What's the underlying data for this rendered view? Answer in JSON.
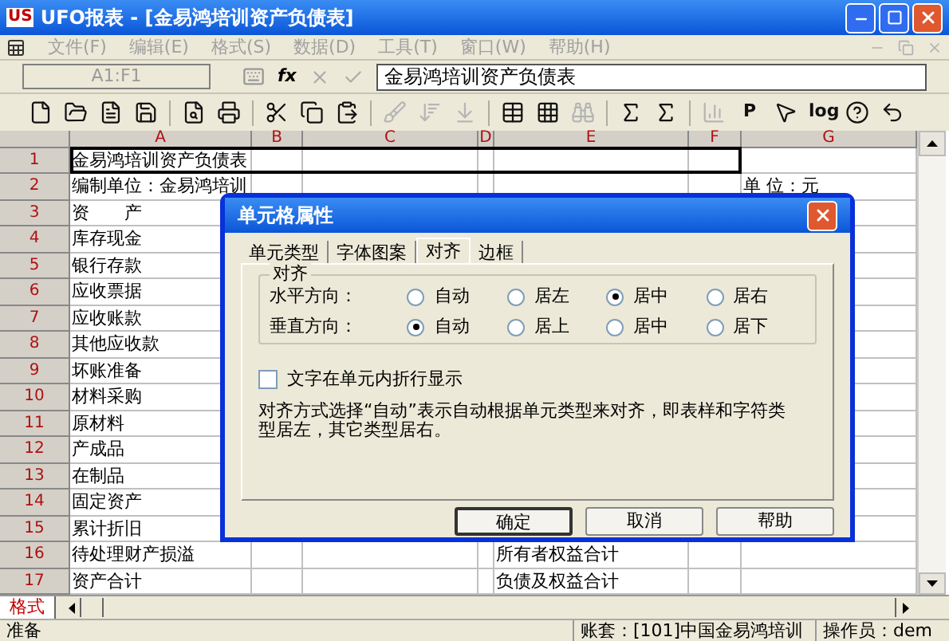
{
  "window": {
    "logo": "US",
    "title": "UFO报表 - [金易鸿培训资产负债表]"
  },
  "menu": [
    {
      "label": "文件(F)",
      "disabled": true
    },
    {
      "label": "编辑(E)",
      "disabled": true
    },
    {
      "label": "格式(S)",
      "disabled": true
    },
    {
      "label": "数据(D)",
      "disabled": true
    },
    {
      "label": "工具(T)",
      "disabled": true
    },
    {
      "label": "窗口(W)",
      "disabled": true
    },
    {
      "label": "帮助(H)",
      "disabled": true
    }
  ],
  "formula_bar": {
    "cell_ref": "A1:F1",
    "function_button": "fx",
    "value": "金易鸿培训资产负债表"
  },
  "toolbar": [
    {
      "kind": "new",
      "disabled": false
    },
    {
      "kind": "open",
      "disabled": false
    },
    {
      "kind": "document",
      "disabled": false
    },
    {
      "kind": "save",
      "disabled": false
    },
    {
      "kind": "separator"
    },
    {
      "kind": "preview",
      "disabled": false
    },
    {
      "kind": "print",
      "disabled": false
    },
    {
      "kind": "separator"
    },
    {
      "kind": "cut",
      "disabled": false
    },
    {
      "kind": "copy",
      "disabled": false
    },
    {
      "kind": "paste",
      "disabled": false
    },
    {
      "kind": "separator"
    },
    {
      "kind": "brush",
      "disabled": true
    },
    {
      "kind": "sort-down",
      "disabled": true
    },
    {
      "kind": "sort-line",
      "disabled": true
    },
    {
      "kind": "separator"
    },
    {
      "kind": "table",
      "disabled": false
    },
    {
      "kind": "grid",
      "disabled": false
    },
    {
      "kind": "find",
      "disabled": true
    },
    {
      "kind": "separator"
    },
    {
      "kind": "sum",
      "disabled": false
    },
    {
      "kind": "sum-down",
      "disabled": false
    },
    {
      "kind": "separator"
    },
    {
      "kind": "chart",
      "disabled": true
    },
    {
      "kind": "text",
      "label": "P",
      "disabled": false
    },
    {
      "kind": "pointer",
      "disabled": false
    },
    {
      "kind": "text",
      "label": "log",
      "disabled": false
    },
    {
      "kind": "help",
      "disabled": false
    },
    {
      "kind": "undo",
      "disabled": false
    }
  ],
  "columns": [
    "A",
    "B",
    "C",
    "D",
    "E",
    "F",
    "G"
  ],
  "rows": [
    {
      "number": "1",
      "col_a": "金易鸿培训资产负债表"
    },
    {
      "number": "2",
      "col_a": "编制单位：金易鸿培训",
      "col_g": "单 位：元"
    },
    {
      "number": "3",
      "col_a": "资　　产"
    },
    {
      "number": "4",
      "col_a": "库存现金"
    },
    {
      "number": "5",
      "col_a": "银行存款"
    },
    {
      "number": "6",
      "col_a": "应收票据"
    },
    {
      "number": "7",
      "col_a": "应收账款"
    },
    {
      "number": "8",
      "col_a": "其他应收款"
    },
    {
      "number": "9",
      "col_a": "坏账准备"
    },
    {
      "number": "10",
      "col_a": "材料采购"
    },
    {
      "number": "11",
      "col_a": "原材料"
    },
    {
      "number": "12",
      "col_a": "产成品"
    },
    {
      "number": "13",
      "col_a": "在制品"
    },
    {
      "number": "14",
      "col_a": "固定资产"
    },
    {
      "number": "15",
      "col_a": "累计折旧"
    },
    {
      "number": "16",
      "col_a": "待处理财产损溢",
      "col_e": "所有者权益合计"
    },
    {
      "number": "17",
      "col_a": "资产合计",
      "col_e": "负债及权益合计"
    }
  ],
  "sheet_tabs": [
    {
      "label": "格式",
      "selected": true
    }
  ],
  "status_bar": {
    "message": "准备",
    "account": "账套：[101]中国金易鸿培训",
    "operator": "操作员：dem"
  },
  "dialog": {
    "title": "单元格属性",
    "tabs": [
      {
        "label": "单元类型",
        "selected": false
      },
      {
        "label": "字体图案",
        "selected": false
      },
      {
        "label": "对齐",
        "selected": true
      },
      {
        "label": "边框",
        "selected": false
      }
    ],
    "group_title": "对齐",
    "alignment_rows": [
      {
        "label": "水平方向：",
        "options": [
          {
            "label": "自动",
            "selected": false
          },
          {
            "label": "居左",
            "selected": false
          },
          {
            "label": "居中",
            "selected": true
          },
          {
            "label": "居右",
            "selected": false
          }
        ]
      },
      {
        "label": "垂直方向：",
        "options": [
          {
            "label": "自动",
            "selected": true
          },
          {
            "label": "居上",
            "selected": false
          },
          {
            "label": "居中",
            "selected": false
          },
          {
            "label": "居下",
            "selected": false
          }
        ]
      }
    ],
    "wrap_checkbox": {
      "label": "文字在单元内折行显示",
      "checked": false
    },
    "description": "对齐方式选择“自动”表示自动根据单元类型来对齐，即表样和字符类型居左，其它类型居右。",
    "buttons": [
      {
        "label": "确定",
        "default": true
      },
      {
        "label": "取消",
        "default": false
      },
      {
        "label": "帮助",
        "default": false
      }
    ]
  }
}
